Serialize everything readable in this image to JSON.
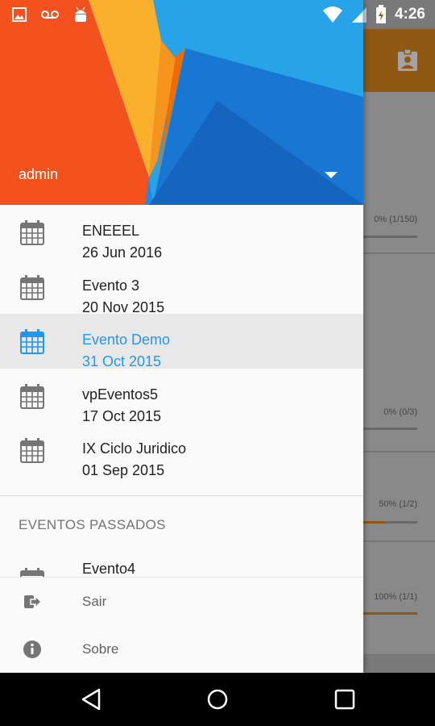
{
  "status_bar": {
    "time": "4:26",
    "icons": [
      "image-icon",
      "voicemail-icon",
      "android-icon",
      "wifi-icon",
      "signal-icon",
      "battery-icon"
    ]
  },
  "drawer": {
    "account": {
      "name": "admin"
    },
    "events": [
      {
        "name": "ENEEEL",
        "date": "26 Jun 2016",
        "selected": false
      },
      {
        "name": "Evento 3",
        "date": "20 Nov 2015",
        "selected": false
      },
      {
        "name": "Evento Demo",
        "date": "31 Oct 2015",
        "selected": true
      },
      {
        "name": "vpEventos5",
        "date": "17 Oct 2015",
        "selected": false
      },
      {
        "name": "IX Ciclo Juridico",
        "date": "01 Sep 2015",
        "selected": false
      }
    ],
    "past_section_title": "EVENTOS PASSADOS",
    "past_events": [
      {
        "name": "Evento4"
      }
    ],
    "menu": [
      {
        "label": "Sair",
        "icon": "logout-icon"
      },
      {
        "label": "Sobre",
        "icon": "info-icon"
      }
    ],
    "colors": {
      "selected": "#2196f3",
      "header_orange": "#f4511e",
      "header_blue": "#1e88e5"
    }
  },
  "background_app": {
    "progress_items": [
      {
        "text": "0% (1/150)",
        "fraction": 0.0067
      },
      {
        "text": "0% (0/3)",
        "fraction": 0
      },
      {
        "text": "50% (1/2)",
        "fraction": 0.5
      },
      {
        "text": "100% (1/1)",
        "fraction": 1
      }
    ]
  }
}
